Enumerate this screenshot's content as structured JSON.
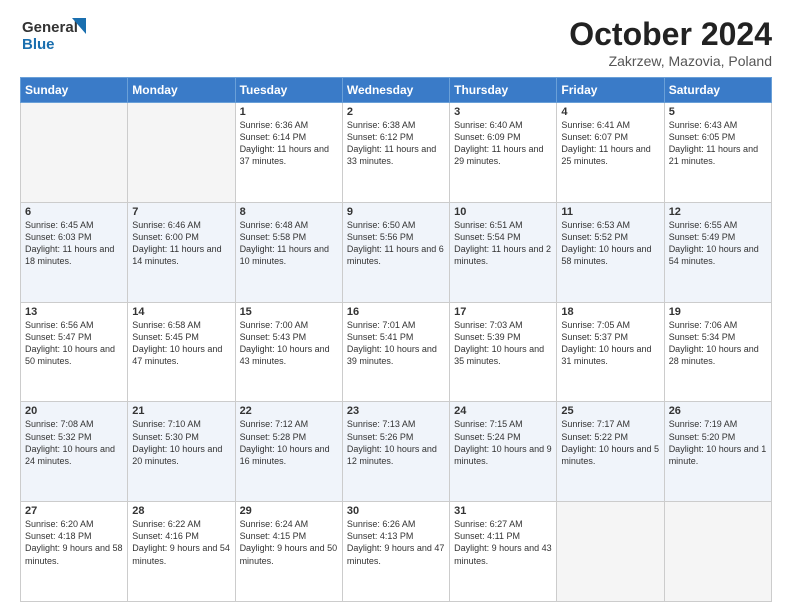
{
  "header": {
    "logo_line1": "General",
    "logo_line2": "Blue",
    "month": "October 2024",
    "location": "Zakrzew, Mazovia, Poland"
  },
  "days_of_week": [
    "Sunday",
    "Monday",
    "Tuesday",
    "Wednesday",
    "Thursday",
    "Friday",
    "Saturday"
  ],
  "weeks": [
    [
      {
        "num": "",
        "content": ""
      },
      {
        "num": "",
        "content": ""
      },
      {
        "num": "1",
        "content": "Sunrise: 6:36 AM\nSunset: 6:14 PM\nDaylight: 11 hours\nand 37 minutes."
      },
      {
        "num": "2",
        "content": "Sunrise: 6:38 AM\nSunset: 6:12 PM\nDaylight: 11 hours\nand 33 minutes."
      },
      {
        "num": "3",
        "content": "Sunrise: 6:40 AM\nSunset: 6:09 PM\nDaylight: 11 hours\nand 29 minutes."
      },
      {
        "num": "4",
        "content": "Sunrise: 6:41 AM\nSunset: 6:07 PM\nDaylight: 11 hours\nand 25 minutes."
      },
      {
        "num": "5",
        "content": "Sunrise: 6:43 AM\nSunset: 6:05 PM\nDaylight: 11 hours\nand 21 minutes."
      }
    ],
    [
      {
        "num": "6",
        "content": "Sunrise: 6:45 AM\nSunset: 6:03 PM\nDaylight: 11 hours\nand 18 minutes."
      },
      {
        "num": "7",
        "content": "Sunrise: 6:46 AM\nSunset: 6:00 PM\nDaylight: 11 hours\nand 14 minutes."
      },
      {
        "num": "8",
        "content": "Sunrise: 6:48 AM\nSunset: 5:58 PM\nDaylight: 11 hours\nand 10 minutes."
      },
      {
        "num": "9",
        "content": "Sunrise: 6:50 AM\nSunset: 5:56 PM\nDaylight: 11 hours\nand 6 minutes."
      },
      {
        "num": "10",
        "content": "Sunrise: 6:51 AM\nSunset: 5:54 PM\nDaylight: 11 hours\nand 2 minutes."
      },
      {
        "num": "11",
        "content": "Sunrise: 6:53 AM\nSunset: 5:52 PM\nDaylight: 10 hours\nand 58 minutes."
      },
      {
        "num": "12",
        "content": "Sunrise: 6:55 AM\nSunset: 5:49 PM\nDaylight: 10 hours\nand 54 minutes."
      }
    ],
    [
      {
        "num": "13",
        "content": "Sunrise: 6:56 AM\nSunset: 5:47 PM\nDaylight: 10 hours\nand 50 minutes."
      },
      {
        "num": "14",
        "content": "Sunrise: 6:58 AM\nSunset: 5:45 PM\nDaylight: 10 hours\nand 47 minutes."
      },
      {
        "num": "15",
        "content": "Sunrise: 7:00 AM\nSunset: 5:43 PM\nDaylight: 10 hours\nand 43 minutes."
      },
      {
        "num": "16",
        "content": "Sunrise: 7:01 AM\nSunset: 5:41 PM\nDaylight: 10 hours\nand 39 minutes."
      },
      {
        "num": "17",
        "content": "Sunrise: 7:03 AM\nSunset: 5:39 PM\nDaylight: 10 hours\nand 35 minutes."
      },
      {
        "num": "18",
        "content": "Sunrise: 7:05 AM\nSunset: 5:37 PM\nDaylight: 10 hours\nand 31 minutes."
      },
      {
        "num": "19",
        "content": "Sunrise: 7:06 AM\nSunset: 5:34 PM\nDaylight: 10 hours\nand 28 minutes."
      }
    ],
    [
      {
        "num": "20",
        "content": "Sunrise: 7:08 AM\nSunset: 5:32 PM\nDaylight: 10 hours\nand 24 minutes."
      },
      {
        "num": "21",
        "content": "Sunrise: 7:10 AM\nSunset: 5:30 PM\nDaylight: 10 hours\nand 20 minutes."
      },
      {
        "num": "22",
        "content": "Sunrise: 7:12 AM\nSunset: 5:28 PM\nDaylight: 10 hours\nand 16 minutes."
      },
      {
        "num": "23",
        "content": "Sunrise: 7:13 AM\nSunset: 5:26 PM\nDaylight: 10 hours\nand 12 minutes."
      },
      {
        "num": "24",
        "content": "Sunrise: 7:15 AM\nSunset: 5:24 PM\nDaylight: 10 hours\nand 9 minutes."
      },
      {
        "num": "25",
        "content": "Sunrise: 7:17 AM\nSunset: 5:22 PM\nDaylight: 10 hours\nand 5 minutes."
      },
      {
        "num": "26",
        "content": "Sunrise: 7:19 AM\nSunset: 5:20 PM\nDaylight: 10 hours\nand 1 minute."
      }
    ],
    [
      {
        "num": "27",
        "content": "Sunrise: 6:20 AM\nSunset: 4:18 PM\nDaylight: 9 hours\nand 58 minutes."
      },
      {
        "num": "28",
        "content": "Sunrise: 6:22 AM\nSunset: 4:16 PM\nDaylight: 9 hours\nand 54 minutes."
      },
      {
        "num": "29",
        "content": "Sunrise: 6:24 AM\nSunset: 4:15 PM\nDaylight: 9 hours\nand 50 minutes."
      },
      {
        "num": "30",
        "content": "Sunrise: 6:26 AM\nSunset: 4:13 PM\nDaylight: 9 hours\nand 47 minutes."
      },
      {
        "num": "31",
        "content": "Sunrise: 6:27 AM\nSunset: 4:11 PM\nDaylight: 9 hours\nand 43 minutes."
      },
      {
        "num": "",
        "content": ""
      },
      {
        "num": "",
        "content": ""
      }
    ]
  ]
}
